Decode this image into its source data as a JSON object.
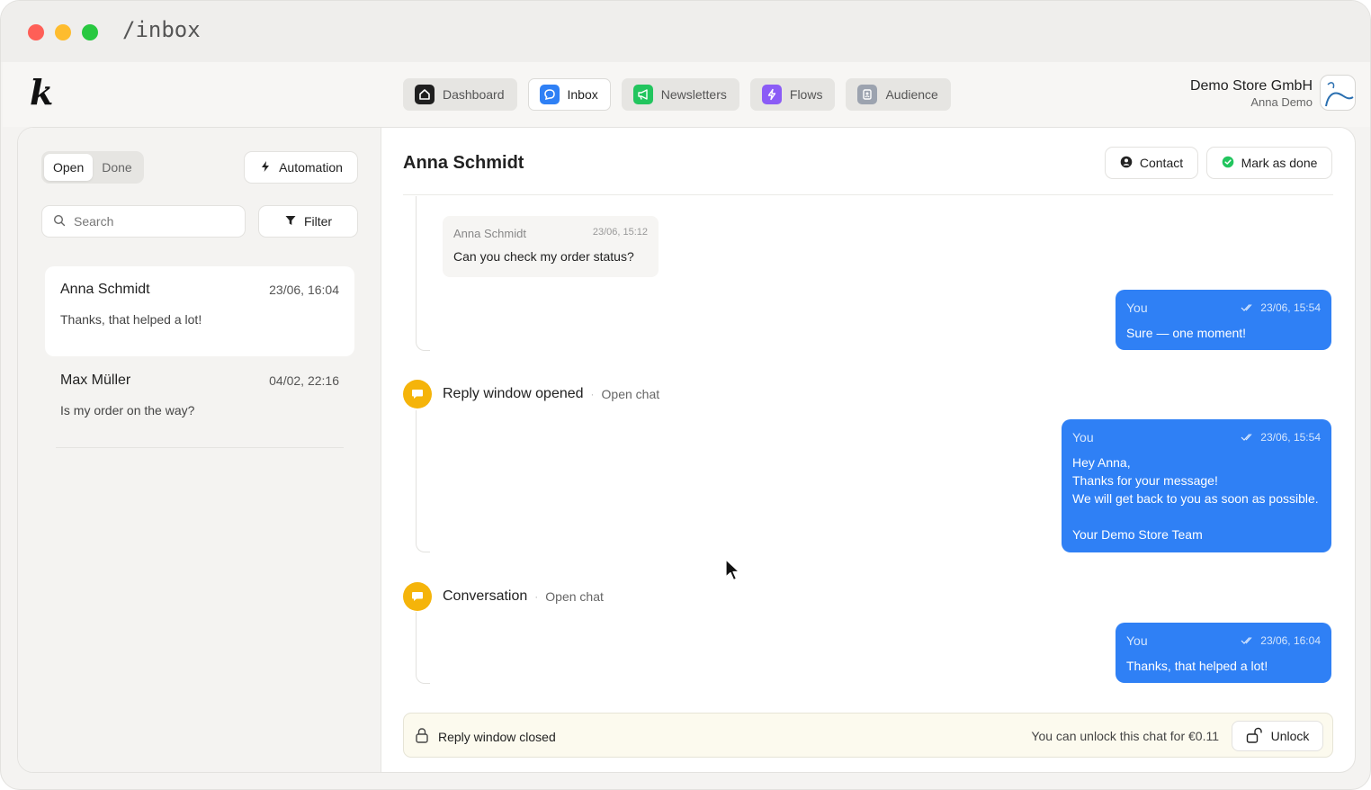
{
  "window": {
    "path": "/inbox"
  },
  "app": {
    "logo": "k",
    "nav": [
      {
        "label": "Dashboard",
        "icon": "home-icon",
        "color": "#1f1f1f"
      },
      {
        "label": "Inbox",
        "icon": "chat-bubble-icon",
        "color": "#2f80f5"
      },
      {
        "label": "Newsletters",
        "icon": "megaphone-icon",
        "color": "#22c55e"
      },
      {
        "label": "Flows",
        "icon": "lightning-icon",
        "color": "#8b5cf6"
      },
      {
        "label": "Audience",
        "icon": "contacts-icon",
        "color": "#9ca3af"
      }
    ],
    "store": {
      "name": "Demo Store GmbH",
      "user": "Anna Demo"
    }
  },
  "sidebar": {
    "tabs": {
      "open": "Open",
      "done": "Done"
    },
    "automation_label": "Automation",
    "search_placeholder": "Search",
    "filter_label": "Filter",
    "conversations": [
      {
        "name": "Anna Schmidt",
        "date": "23/06, 16:04",
        "preview": "Thanks, that helped a lot!"
      },
      {
        "name": "Max Müller",
        "date": "04/02, 22:16",
        "preview": "Is my order on the way?"
      }
    ]
  },
  "chat": {
    "title": "Anna Schmidt",
    "contact_label": "Contact",
    "mark_done_label": "Mark as done",
    "incoming": {
      "sender": "Anna Schmidt",
      "time": "23/06, 15:12",
      "text": "Can you check my order status?"
    },
    "outgoing": [
      {
        "sender": "You",
        "time": "23/06, 15:54",
        "text": "Sure — one moment!"
      },
      {
        "sender": "You",
        "time": "23/06, 15:54",
        "text": "Hey Anna,\nThanks for your message!\nWe will get back to you as soon as possible.\n\nYour Demo Store Team"
      },
      {
        "sender": "You",
        "time": "23/06, 16:04",
        "text": "Thanks, that helped a lot!"
      }
    ],
    "events": [
      {
        "title": "Reply window opened",
        "sep": "·",
        "sub": "Open chat"
      },
      {
        "title": "Conversation",
        "sep": "·",
        "sub": "Open chat"
      }
    ],
    "closed": {
      "label": "Reply window closed",
      "note": "You can unlock this chat for €0.11",
      "unlock_label": "Unlock"
    }
  },
  "colors": {
    "accent": "#2f80f5",
    "event": "#f5b40a",
    "done_green": "#22c55e"
  }
}
